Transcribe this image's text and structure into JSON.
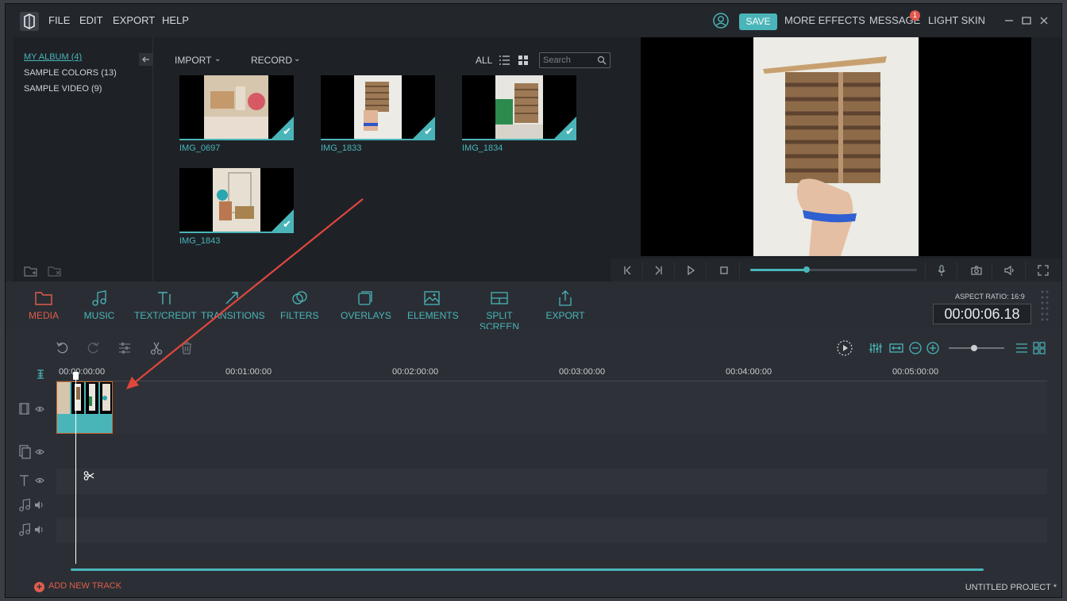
{
  "menu": {
    "file": "FILE",
    "edit": "EDIT",
    "export": "EXPORT",
    "help": "HELP"
  },
  "titlebar": {
    "save": "SAVE",
    "more_effects": "MORE EFFECTS",
    "message": "MESSAGE",
    "message_badge": "1",
    "skin": "LIGHT SKIN"
  },
  "albums": [
    {
      "label": "MY ALBUM (4)"
    },
    {
      "label": "SAMPLE COLORS (13)"
    },
    {
      "label": "SAMPLE VIDEO (9)"
    }
  ],
  "library": {
    "import": "IMPORT",
    "record": "RECORD",
    "all": "ALL",
    "search_placeholder": "Search",
    "items": [
      {
        "label": "IMG_0697"
      },
      {
        "label": "IMG_1833"
      },
      {
        "label": "IMG_1834"
      },
      {
        "label": "IMG_1843"
      }
    ]
  },
  "preview": {
    "progress": 0.34
  },
  "toolbar": {
    "media": "MEDIA",
    "music": "MUSIC",
    "text": "TEXT/CREDIT",
    "transitions": "TRANSITIONS",
    "filters": "FILTERS",
    "overlays": "OVERLAYS",
    "elements": "ELEMENTS",
    "split": "SPLIT SCREEN",
    "export": "EXPORT",
    "aspect": "ASPECT RATIO: 16:9",
    "timecode": "00:00:06.18"
  },
  "timeline": {
    "ticks": [
      "00:00:00:00",
      "00:01:00:00",
      "00:02:00:00",
      "00:03:00:00",
      "00:04:00:00",
      "00:05:00:00"
    ],
    "add_track": "ADD NEW TRACK",
    "project": "UNTITLED PROJECT *",
    "zoom": 0.45
  },
  "colors": {
    "accent": "#4ab5b9",
    "active": "#e05c4c",
    "arrow": "#e0463c"
  }
}
